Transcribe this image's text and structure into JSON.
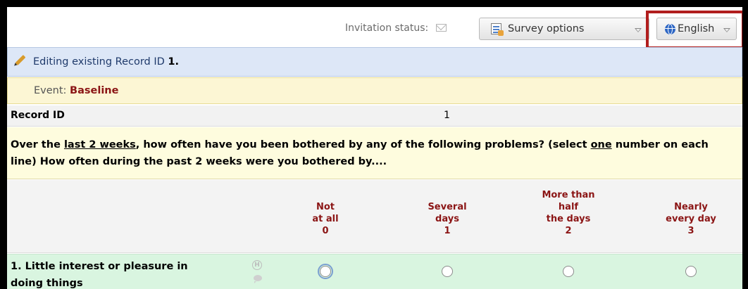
{
  "header": {
    "invitation_status_label": "Invitation status:",
    "survey_options_label": "Survey options",
    "language_label": "English"
  },
  "edit_banner": {
    "prefix": "Editing existing Record ID",
    "record_id": "1."
  },
  "event": {
    "label": "Event:",
    "value": "Baseline"
  },
  "record_row": {
    "label": "Record ID",
    "value": "1"
  },
  "question": {
    "part1": "Over the ",
    "underlined1": "last 2 weeks",
    "part2": ", how often have you been bothered by any of the following problems? (select ",
    "underlined2": "one",
    "part3": " number on each line) How often during the past 2 weeks were you bothered by...."
  },
  "choices": [
    {
      "line1": "",
      "line2": "Not",
      "line3": "at all",
      "code": "0"
    },
    {
      "line1": "",
      "line2": "Several",
      "line3": "days",
      "code": "1"
    },
    {
      "line1": "More than",
      "line2": "half",
      "line3": "the days",
      "code": "2"
    },
    {
      "line1": "",
      "line2": "Nearly",
      "line3": "every day",
      "code": "3"
    }
  ],
  "items": [
    {
      "line1": "1. Little interest or pleasure in",
      "line2": "doing things",
      "history_icon": "H",
      "selected": null
    }
  ],
  "colors": {
    "highlight_box": "#b11e1e",
    "choice_label": "#8b1515",
    "item_row_bg": "#d9f5e0",
    "question_bg": "#fefcde"
  },
  "icons": [
    "envelope-icon",
    "survey-options-icon",
    "globe-icon",
    "chevron-down-icon",
    "pencil-icon",
    "field-history-icon",
    "comment-icon"
  ]
}
